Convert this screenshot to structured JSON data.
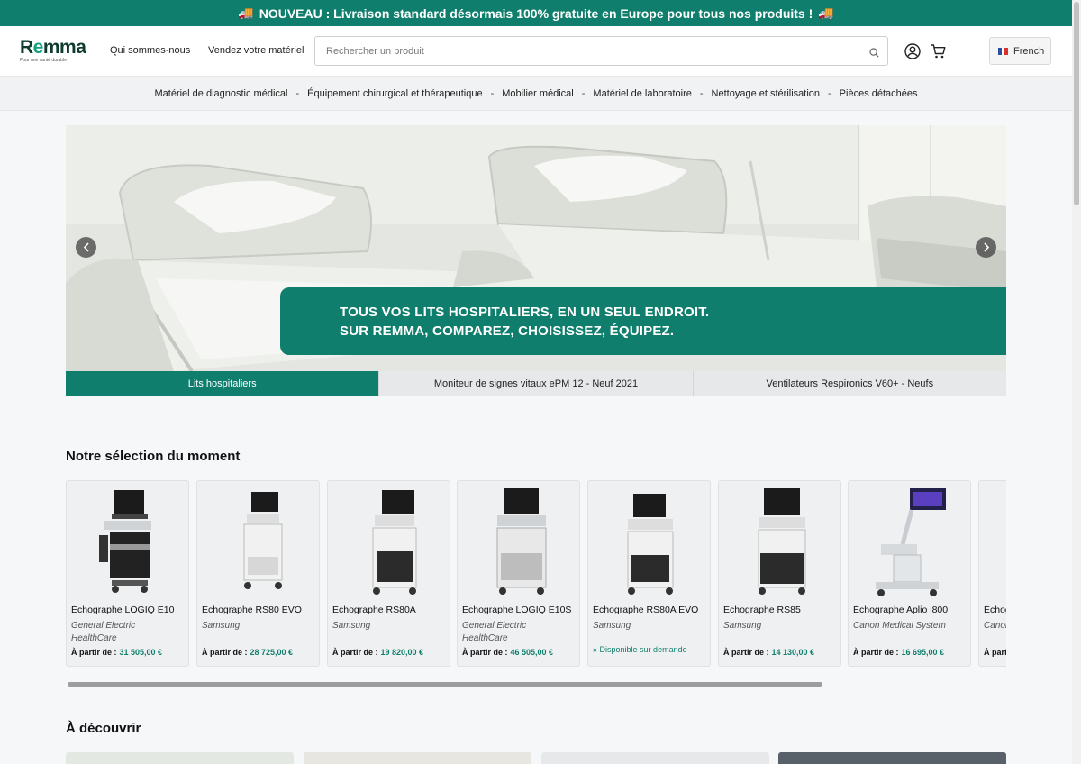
{
  "announcement": {
    "text": "NOUVEAU : Livraison standard désormais 100% gratuite en Europe pour tous nos produits !",
    "icon": "truck-emoji"
  },
  "header": {
    "logo_text": "Remma",
    "logo_tagline": "Pour une santé durable",
    "nav": [
      "Qui sommes-nous",
      "Vendez votre matériel"
    ],
    "search_placeholder": "Rechercher un produit",
    "language": "French"
  },
  "categories": [
    "Matériel de diagnostic médical",
    "Équipement chirurgical et thérapeutique",
    "Mobilier médical",
    "Matériel de laboratoire",
    "Nettoyage et stérilisation",
    "Pièces détachées"
  ],
  "hero": {
    "headline_1": "TOUS VOS LITS HOSPITALIERS, EN UN SEUL ENDROIT.",
    "headline_2": "SUR REMMA, COMPAREZ, CHOISISSEZ, ÉQUIPEZ.",
    "tabs": [
      "Lits hospitaliers",
      "Moniteur de signes vitaux ePM 12 - Neuf 2021",
      "Ventilateurs Respironics V60+ - Neufs"
    ],
    "active_tab": 0
  },
  "selection": {
    "title": "Notre sélection du moment",
    "price_prefix": "À partir de :",
    "products": [
      {
        "name": "Échographe LOGIQ E10",
        "brand": "General Electric HealthCare",
        "price": "31 505,00 €"
      },
      {
        "name": "Echographe RS80 EVO",
        "brand": "Samsung",
        "price": "28 725,00 €"
      },
      {
        "name": "Echographe RS80A",
        "brand": "Samsung",
        "price": "19 820,00 €"
      },
      {
        "name": "Echographe LOGIQ E10S",
        "brand": "General Electric HealthCare",
        "price": "46 505,00 €"
      },
      {
        "name": "Échographe RS80A EVO",
        "brand": "Samsung",
        "availability": "Disponible sur demande"
      },
      {
        "name": "Echographe RS85",
        "brand": "Samsung",
        "price": "14 130,00 €"
      },
      {
        "name": "Échographe Aplio i800",
        "brand": "Canon Medical System",
        "price": "16 695,00 €"
      },
      {
        "name": "Échographe",
        "brand": "Canon",
        "price": ""
      }
    ]
  },
  "discover": {
    "title": "À découvrir"
  },
  "colors": {
    "brand_green": "#0f7e6c",
    "logo_dark": "#0e3a2f"
  }
}
